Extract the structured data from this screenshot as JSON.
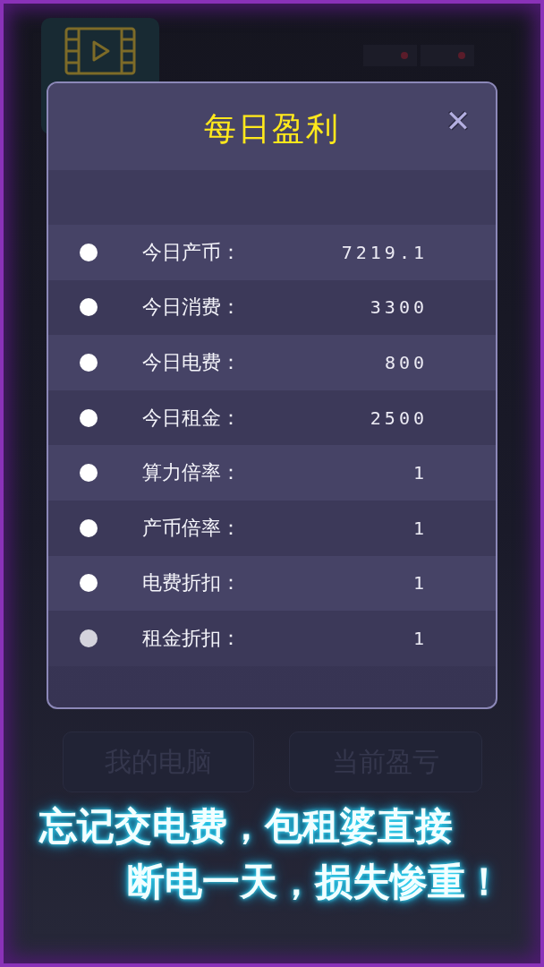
{
  "background": {
    "buttons": [
      "我的电脑",
      "当前盈亏"
    ]
  },
  "dialog": {
    "title": "每日盈利",
    "close": "✕",
    "rows": [
      {
        "label": "今日产币：",
        "value": "7219.1"
      },
      {
        "label": "今日消费：",
        "value": "3300"
      },
      {
        "label": "今日电费：",
        "value": "800"
      },
      {
        "label": "今日租金：",
        "value": "2500"
      },
      {
        "label": "算力倍率：",
        "value": "1"
      },
      {
        "label": "产币倍率：",
        "value": "1"
      },
      {
        "label": "电费折扣：",
        "value": "1"
      },
      {
        "label": "租金折扣：",
        "value": "1"
      }
    ]
  },
  "caption": {
    "lines": [
      "忘记交电费，包租婆直接",
      "断电一天，损失惨重！"
    ]
  }
}
